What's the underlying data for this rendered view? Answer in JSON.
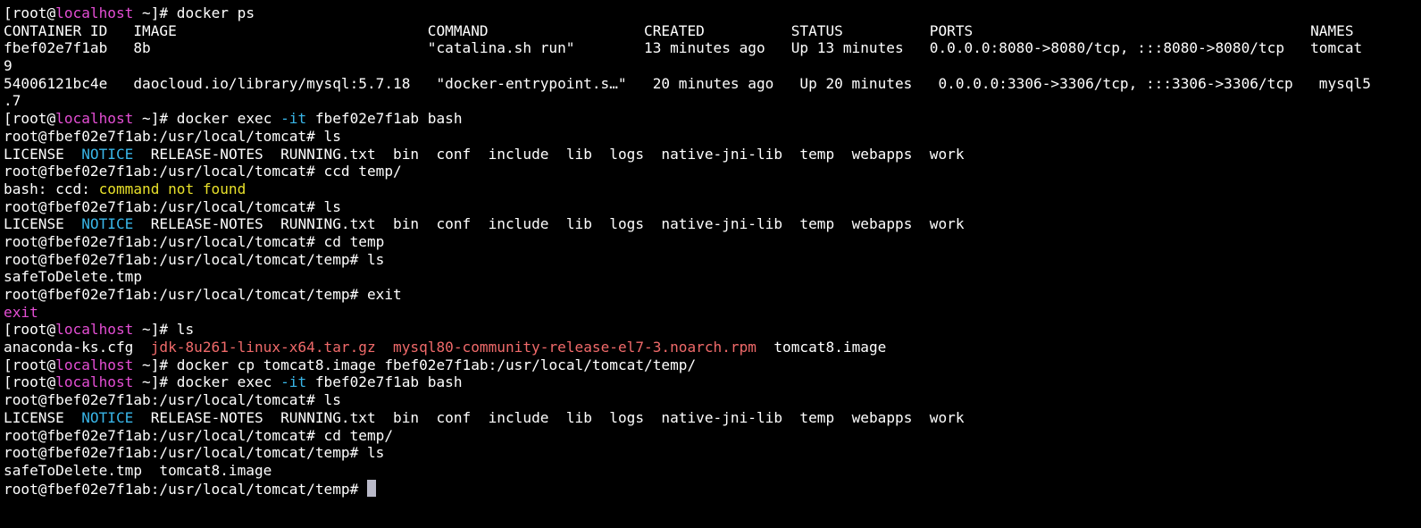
{
  "colors": {
    "background": "#000000",
    "foreground": "#ffffff",
    "hostname": "#e44ed4",
    "option_flag": "#39b6e8",
    "notice_file": "#39b6e8",
    "error_text": "#e8e02a",
    "exit_text": "#e44ed4",
    "archive_file": "#f06a6a",
    "cursor": "#b9b9c8"
  },
  "terminal": {
    "cursor_visible": true,
    "lines": [
      [
        {
          "t": "[root@"
        },
        {
          "t": "localhost",
          "c": "host"
        },
        {
          "t": " ~]# docker ps"
        }
      ],
      [
        {
          "t": "CONTAINER ID   IMAGE                             COMMAND                  CREATED          STATUS          PORTS                                       NAMES"
        }
      ],
      [
        {
          "t": "fbef02e7f1ab   8b                                \"catalina.sh run\"        13 minutes ago   Up 13 minutes   0.0.0.0:8080->8080/tcp, :::8080->8080/tcp   tomcat"
        }
      ],
      [
        {
          "t": "9"
        }
      ],
      [
        {
          "t": "54006121bc4e   daocloud.io/library/mysql:5.7.18   \"docker-entrypoint.s…\"   20 minutes ago   Up 20 minutes   0.0.0.0:3306->3306/tcp, :::3306->3306/tcp   mysql5"
        }
      ],
      [
        {
          "t": ".7"
        }
      ],
      [
        {
          "t": "[root@"
        },
        {
          "t": "localhost",
          "c": "host"
        },
        {
          "t": " ~]# docker exec "
        },
        {
          "t": "-it",
          "c": "cyan"
        },
        {
          "t": " fbef02e7f1ab bash"
        }
      ],
      [
        {
          "t": "root@fbef02e7f1ab:/usr/local/tomcat# ls"
        }
      ],
      [
        {
          "t": "LICENSE  "
        },
        {
          "t": "NOTICE",
          "c": "cyan"
        },
        {
          "t": "  RELEASE-NOTES  RUNNING.txt  bin  conf  include  lib  logs  native-jni-lib  temp  webapps  work"
        }
      ],
      [
        {
          "t": "root@fbef02e7f1ab:/usr/local/tomcat# ccd temp/"
        }
      ],
      [
        {
          "t": "bash: ccd: "
        },
        {
          "t": "command not found",
          "c": "yellow"
        }
      ],
      [
        {
          "t": "root@fbef02e7f1ab:/usr/local/tomcat# ls"
        }
      ],
      [
        {
          "t": "LICENSE  "
        },
        {
          "t": "NOTICE",
          "c": "cyan"
        },
        {
          "t": "  RELEASE-NOTES  RUNNING.txt  bin  conf  include  lib  logs  native-jni-lib  temp  webapps  work"
        }
      ],
      [
        {
          "t": "root@fbef02e7f1ab:/usr/local/tomcat# cd temp"
        }
      ],
      [
        {
          "t": "root@fbef02e7f1ab:/usr/local/tomcat/temp# ls"
        }
      ],
      [
        {
          "t": "safeToDelete.tmp"
        }
      ],
      [
        {
          "t": "root@fbef02e7f1ab:/usr/local/tomcat/temp# exit"
        }
      ],
      [
        {
          "t": "exit",
          "c": "magenta"
        }
      ],
      [
        {
          "t": "[root@"
        },
        {
          "t": "localhost",
          "c": "host"
        },
        {
          "t": " ~]# ls"
        }
      ],
      [
        {
          "t": "anaconda-ks.cfg  "
        },
        {
          "t": "jdk-8u261-linux-x64.tar.gz",
          "c": "red"
        },
        {
          "t": "  "
        },
        {
          "t": "mysql80-community-release-el7-3.noarch.rpm",
          "c": "red"
        },
        {
          "t": "  tomcat8.image"
        }
      ],
      [
        {
          "t": "[root@"
        },
        {
          "t": "localhost",
          "c": "host"
        },
        {
          "t": " ~]# docker cp tomcat8.image fbef02e7f1ab:/usr/local/tomcat/temp/"
        }
      ],
      [
        {
          "t": "[root@"
        },
        {
          "t": "localhost",
          "c": "host"
        },
        {
          "t": " ~]# docker exec "
        },
        {
          "t": "-it",
          "c": "cyan"
        },
        {
          "t": " fbef02e7f1ab bash"
        }
      ],
      [
        {
          "t": "root@fbef02e7f1ab:/usr/local/tomcat# ls"
        }
      ],
      [
        {
          "t": "LICENSE  "
        },
        {
          "t": "NOTICE",
          "c": "cyan"
        },
        {
          "t": "  RELEASE-NOTES  RUNNING.txt  bin  conf  include  lib  logs  native-jni-lib  temp  webapps  work"
        }
      ],
      [
        {
          "t": "root@fbef02e7f1ab:/usr/local/tomcat# cd temp/"
        }
      ],
      [
        {
          "t": "root@fbef02e7f1ab:/usr/local/tomcat/temp# ls"
        }
      ],
      [
        {
          "t": "safeToDelete.tmp  tomcat8.image"
        }
      ],
      [
        {
          "t": "root@fbef02e7f1ab:/usr/local/tomcat/temp# "
        }
      ]
    ]
  }
}
